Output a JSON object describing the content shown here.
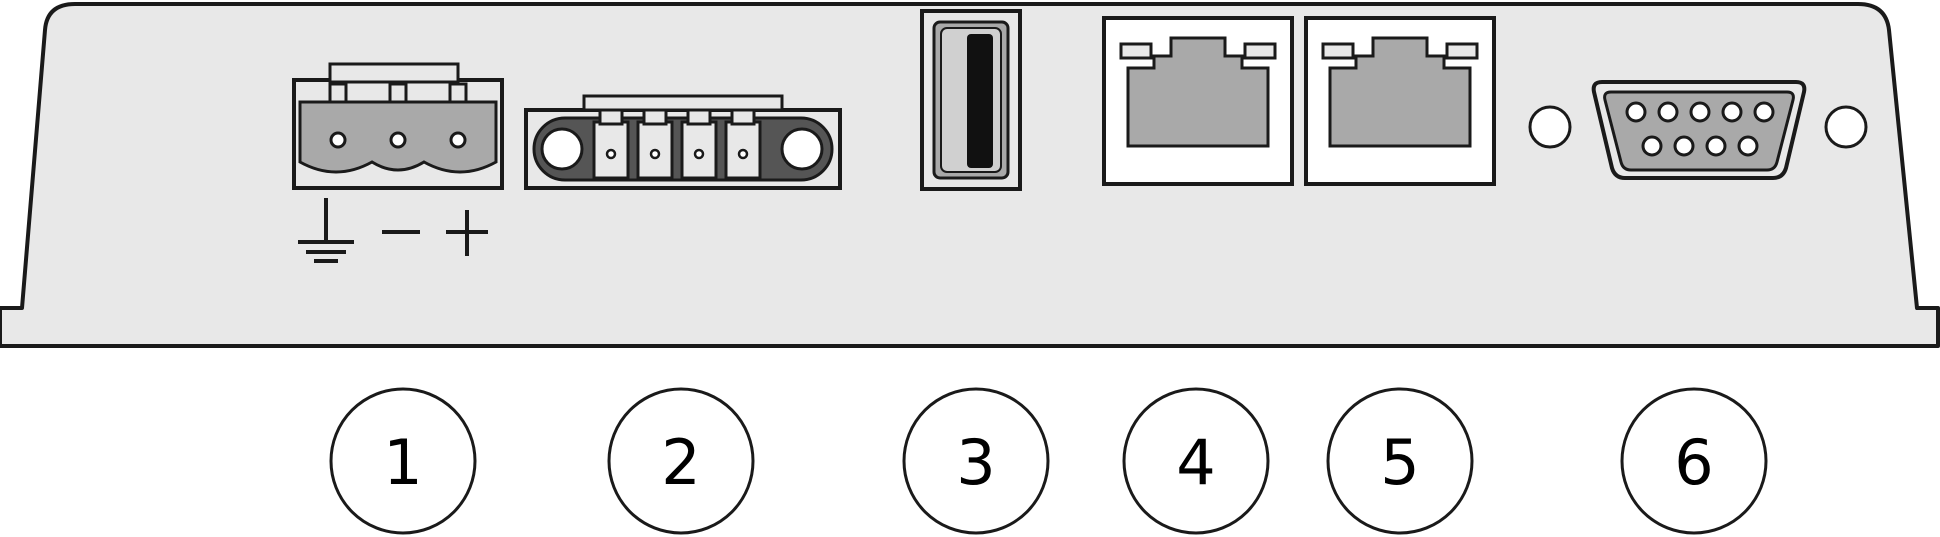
{
  "colors": {
    "housing_fill": "#e8e8e8",
    "outline": "#1a1a1a",
    "connector_fill": "#a9a9a9",
    "port_face": "#ffffff",
    "callout_fill": "#ffffff"
  },
  "callouts": [
    {
      "number": "1",
      "part": "power-terminal"
    },
    {
      "number": "2",
      "part": "four-pin-terminal"
    },
    {
      "number": "3",
      "part": "usb-port"
    },
    {
      "number": "4",
      "part": "ethernet-port-1"
    },
    {
      "number": "5",
      "part": "ethernet-port-2"
    },
    {
      "number": "6",
      "part": "serial-db9-port"
    }
  ]
}
